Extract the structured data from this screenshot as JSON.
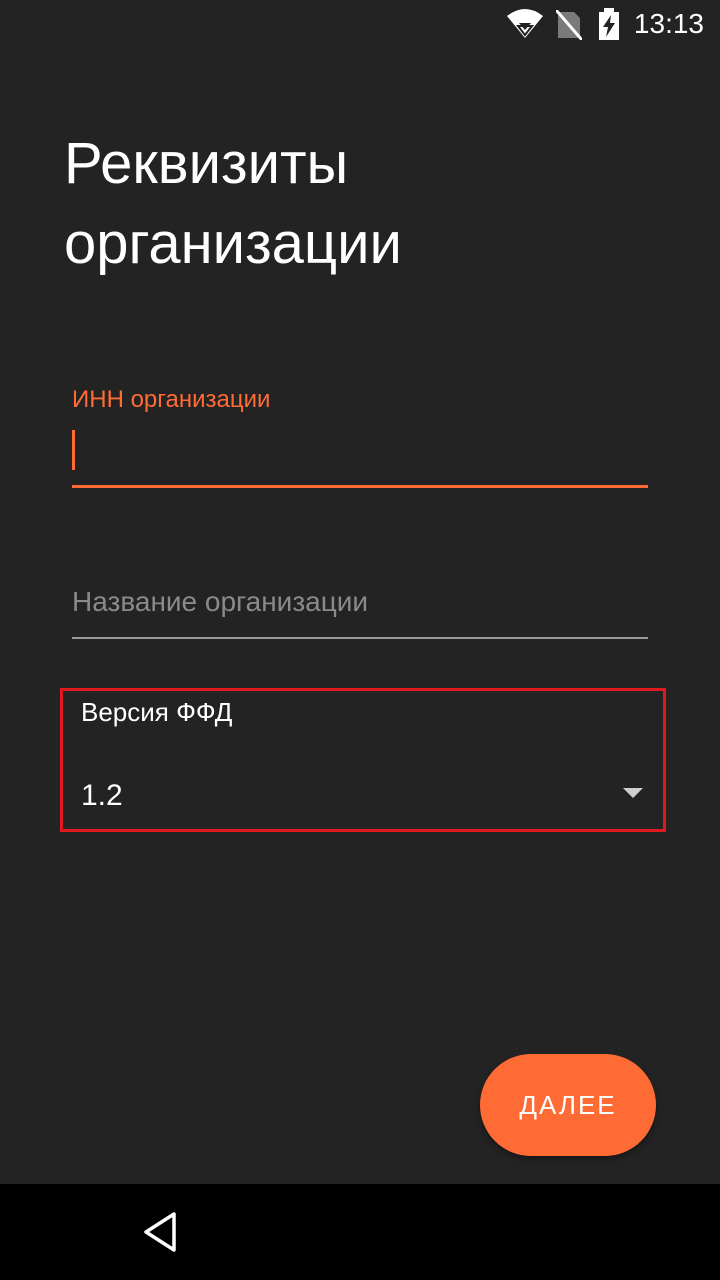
{
  "status_bar": {
    "time": "13:13",
    "icons": [
      "wifi-icon",
      "no-sim-icon",
      "battery-charging-icon"
    ]
  },
  "page": {
    "title": "Реквизиты организации"
  },
  "form": {
    "inn_field": {
      "label": "ИНН организации",
      "value": "",
      "accent_color": "#ff6b35"
    },
    "name_field": {
      "placeholder": "Название организации",
      "value": ""
    },
    "ffd_version": {
      "label": "Версия ФФД",
      "selected": "1.2"
    }
  },
  "actions": {
    "next_label": "ДАЛЕЕ"
  },
  "nav": {
    "icons": [
      "back-icon"
    ]
  },
  "colors": {
    "background": "#232323",
    "accent": "#ff6b35",
    "highlight_border": "#e0191e"
  }
}
